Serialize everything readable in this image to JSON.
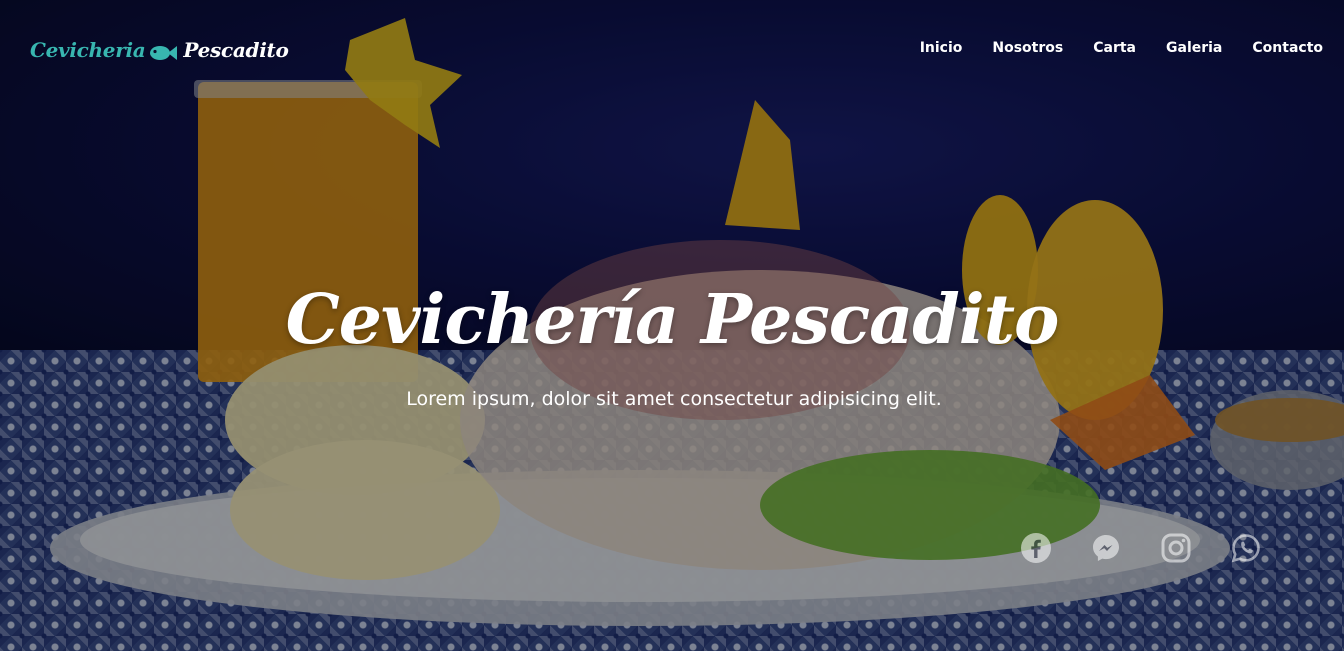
{
  "brand": {
    "name_part1": "Cevicheria",
    "name_part2": "Pescadito",
    "accent_color": "#38b6b0"
  },
  "nav": {
    "items": [
      {
        "label": "Inicio"
      },
      {
        "label": "Nosotros"
      },
      {
        "label": "Carta"
      },
      {
        "label": "Galeria"
      },
      {
        "label": "Contacto"
      }
    ]
  },
  "hero": {
    "title": "Cevichería Pescadito",
    "subtitle": "Lorem ipsum, dolor sit amet consectetur adipisicing elit.",
    "background": "ceviche-plate-photo"
  },
  "socials": [
    {
      "icon": "facebook-icon"
    },
    {
      "icon": "messenger-icon"
    },
    {
      "icon": "instagram-icon"
    },
    {
      "icon": "whatsapp-icon"
    }
  ]
}
